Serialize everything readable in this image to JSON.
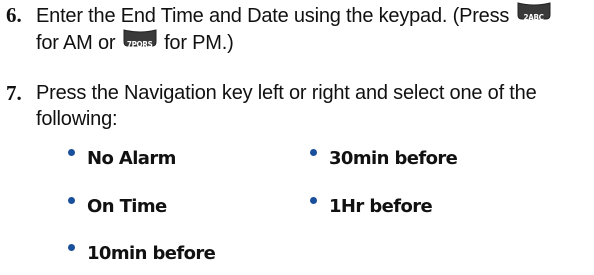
{
  "step6": {
    "number": "6.",
    "line1_a": "Enter the End Time and Date using the keypad. (Press",
    "key_am": {
      "label": "2ABC",
      "icon": "key-2abc-icon"
    },
    "line2_a": "for AM or",
    "key_pm": {
      "label": "7PQRS",
      "icon": "key-7pqrs-icon"
    },
    "line2_b": "for PM.)"
  },
  "step7": {
    "number": "7.",
    "line1": "Press the Navigation key left or right and select one of the",
    "line2": "following:"
  },
  "options": [
    {
      "label": "No Alarm"
    },
    {
      "label": "30min before"
    },
    {
      "label": "On Time"
    },
    {
      "label": "1Hr before"
    },
    {
      "label": "10min before"
    }
  ],
  "colors": {
    "bullet": "#1a4f9c",
    "key_face": "#3a3a3a",
    "text": "#111111"
  }
}
